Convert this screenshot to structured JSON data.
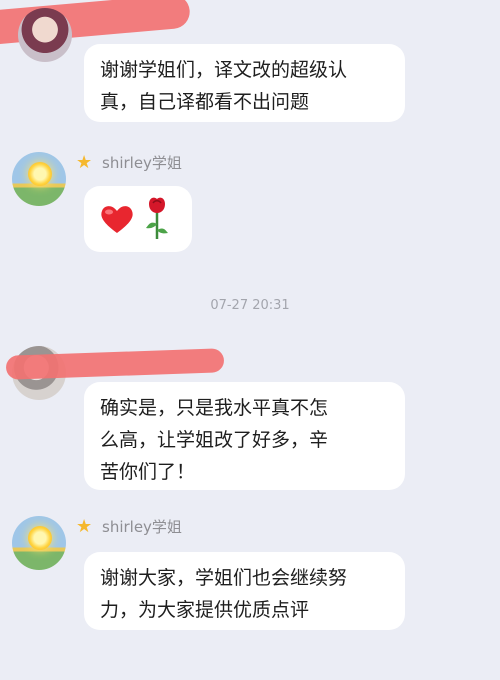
{
  "messages": [
    {
      "text_lines": [
        "谢谢学姐们，译文改的超级认",
        "真，自己译都看不出问题"
      ]
    },
    {
      "sender": "shirley学姐",
      "emoji": [
        "red-heart",
        "rose"
      ]
    },
    {
      "timestamp": "07-27 20:31"
    },
    {
      "text_lines": [
        "确实是，只是我水平真不怎",
        "么高，让学姐改了好多，辛",
        "苦你们了！"
      ]
    },
    {
      "sender": "shirley学姐",
      "text_lines": [
        "谢谢大家，学姐们也会继续努",
        "力，为大家提供优质点评"
      ]
    }
  ],
  "colors": {
    "background": "#ebedf5",
    "bubble": "#ffffff",
    "redaction": "#f27272",
    "star": "#f5b82e"
  }
}
